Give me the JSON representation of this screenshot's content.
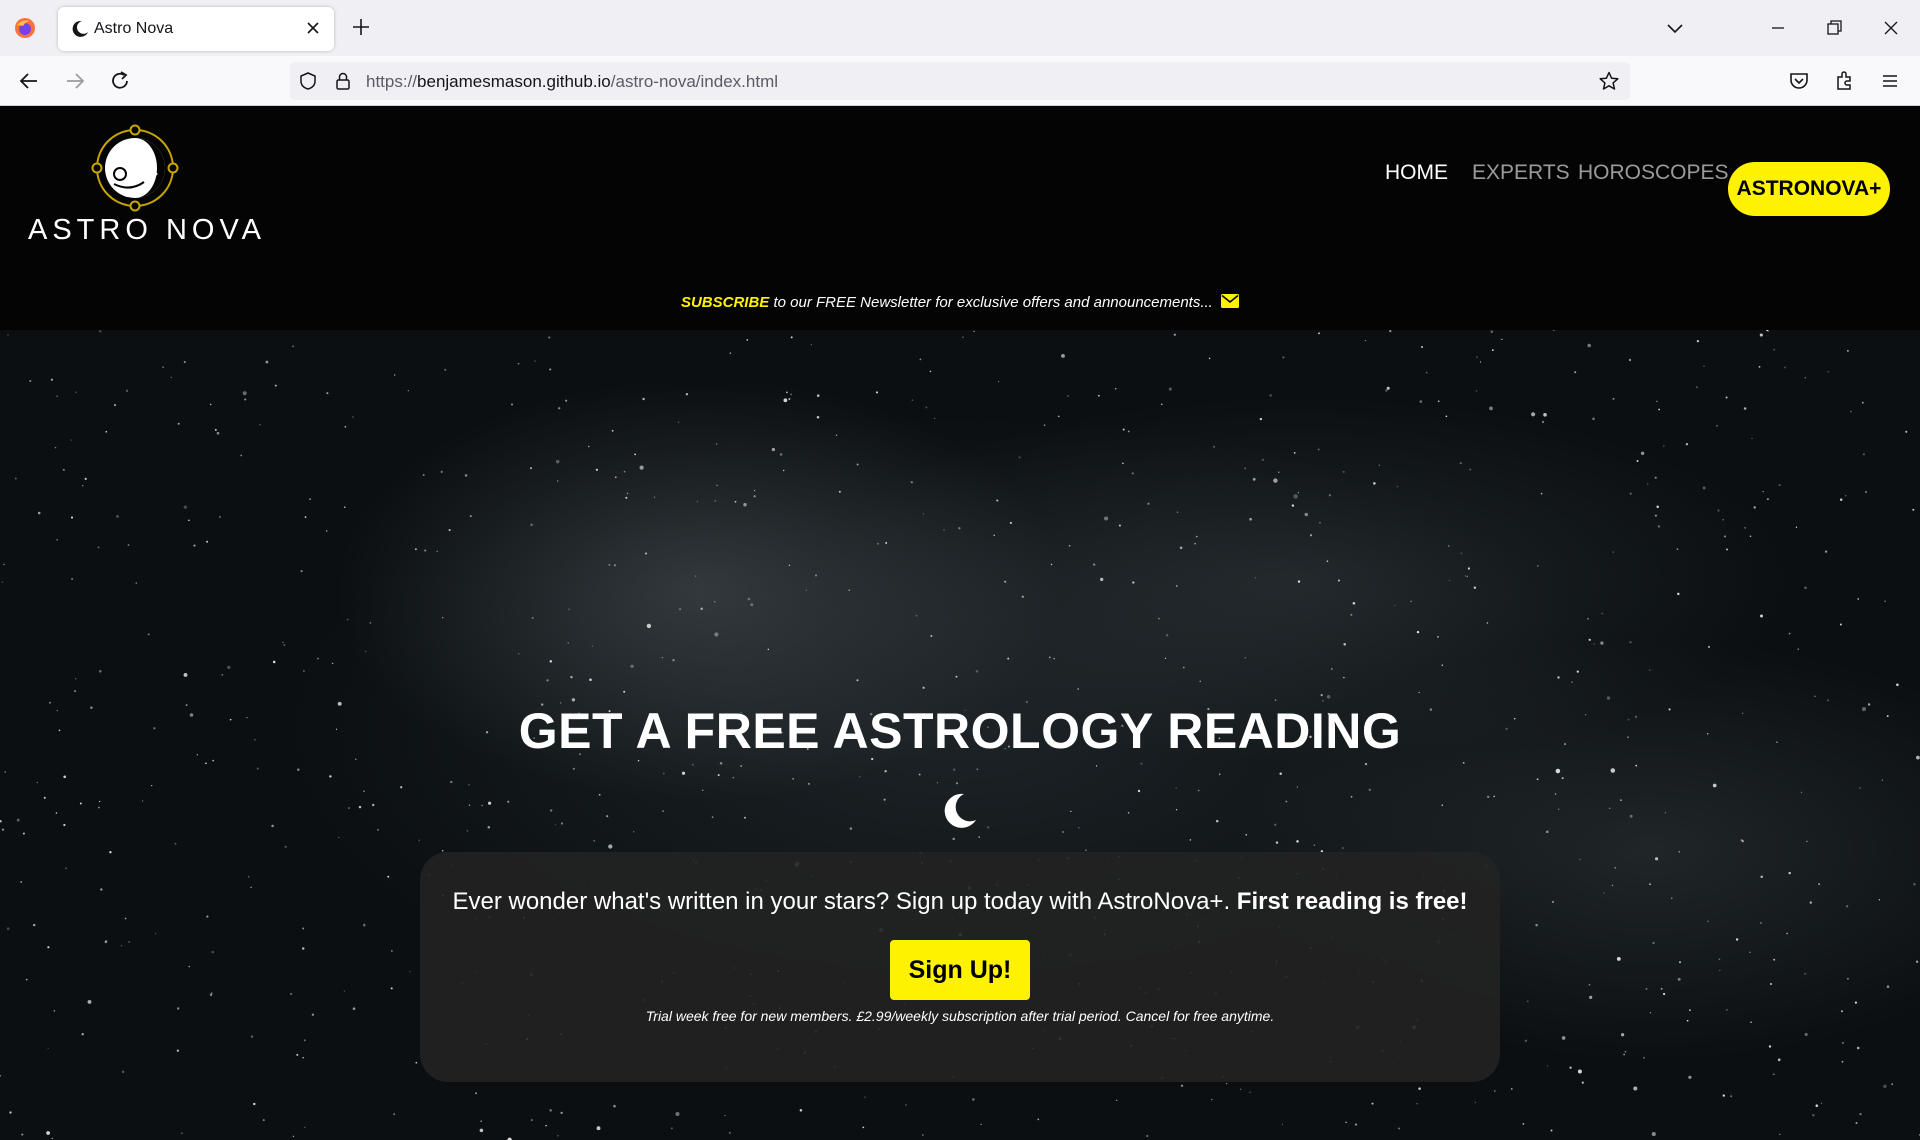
{
  "browser": {
    "tab_title": "Astro Nova",
    "url_scheme": "https://",
    "url_host": "benjamesmason.github.io",
    "url_path": "/astro-nova/index.html"
  },
  "site": {
    "brand": "ASTRO NOVA",
    "nav": {
      "home": "HOME",
      "experts": "EXPERTS",
      "horoscopes": "HOROSCOPES",
      "cta": "ASTRONOVA+"
    },
    "newsletter": {
      "highlight": "SUBSCRIBE",
      "text": " to our FREE Newsletter for exclusive offers and announcements... "
    },
    "colors": {
      "accent": "#fff200",
      "header_bg": "#040404",
      "card_bg": "#222222"
    }
  },
  "hero": {
    "title": "GET A FREE ASTROLOGY READING",
    "card_text": "Ever wonder what's written in your stars? Sign up today with AstroNova+. ",
    "card_bold": "First reading is free!",
    "button": "Sign Up!",
    "fine_print": "Trial week free for new members. £2.99/weekly subscription after trial period. Cancel for free anytime."
  }
}
